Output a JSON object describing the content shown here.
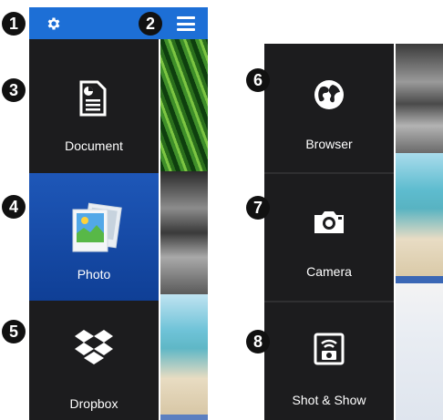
{
  "callouts": [
    "1",
    "2",
    "3",
    "4",
    "5",
    "6",
    "7",
    "8"
  ],
  "left_panel": {
    "items": [
      {
        "label": "Document",
        "icon": "document-icon"
      },
      {
        "label": "Photo",
        "icon": "photo-icon",
        "active": true
      },
      {
        "label": "Dropbox",
        "icon": "dropbox-icon"
      }
    ]
  },
  "right_panel": {
    "items": [
      {
        "label": "Browser",
        "icon": "globe-icon"
      },
      {
        "label": "Camera",
        "icon": "camera-icon"
      },
      {
        "label": "Shot & Show",
        "icon": "shot-show-icon"
      }
    ]
  },
  "colors": {
    "topbar": "#1d6fd6",
    "menu_bg": "#1c1c1e",
    "active_tile": "#1a4fae"
  }
}
